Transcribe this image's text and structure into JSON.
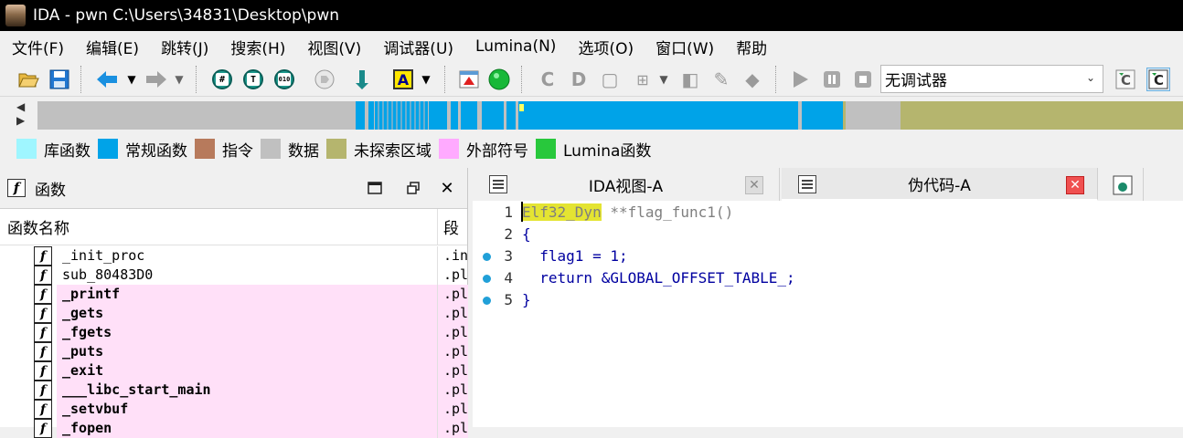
{
  "window": {
    "title": "IDA - pwn C:\\Users\\34831\\Desktop\\pwn"
  },
  "menu": [
    "文件(F)",
    "编辑(E)",
    "跳转(J)",
    "搜索(H)",
    "视图(V)",
    "调试器(U)",
    "Lumina(N)",
    "选项(O)",
    "窗口(W)",
    "帮助"
  ],
  "toolbar": {
    "icons": [
      "open-icon",
      "save-icon",
      "back-arrow-icon",
      "forward-arrow-icon",
      "hash-icon",
      "text-icon",
      "binary-icon",
      "script-icon",
      "jump-icon",
      "font-a-icon",
      "flag-icon",
      "green-circle-icon",
      "code-c-icon",
      "data-d-icon",
      "struct-icon",
      "plus-icon",
      "pointer-icon",
      "hammer-icon",
      "diamond-icon",
      "play-icon",
      "pause-icon",
      "stop-icon",
      "refresh-c-icon",
      "refresh-c-active-icon"
    ],
    "debugger_select": "无调试器"
  },
  "legend": [
    {
      "label": "库函数",
      "color": "#9ff6ff"
    },
    {
      "label": "常规函数",
      "color": "#00a3e8"
    },
    {
      "label": "指令",
      "color": "#b77a5c"
    },
    {
      "label": "数据",
      "color": "#c0c0c0"
    },
    {
      "label": "未探索区域",
      "color": "#b5b56e"
    },
    {
      "label": "外部符号",
      "color": "#ffaaff"
    },
    {
      "label": "Lumina函数",
      "color": "#28c83c"
    }
  ],
  "functions_panel": {
    "title": "函数",
    "col_name": "函数名称",
    "col_segment": "段",
    "rows": [
      {
        "name": "_init_proc",
        "segment": ".init",
        "highlight": false
      },
      {
        "name": "sub_80483D0",
        "segment": ".plt",
        "highlight": false
      },
      {
        "name": "_printf",
        "segment": ".plt",
        "highlight": true
      },
      {
        "name": "_gets",
        "segment": ".plt",
        "highlight": true
      },
      {
        "name": "_fgets",
        "segment": ".plt",
        "highlight": true
      },
      {
        "name": "_puts",
        "segment": ".plt",
        "highlight": true
      },
      {
        "name": "_exit",
        "segment": ".plt",
        "highlight": true
      },
      {
        "name": "___libc_start_main",
        "segment": ".plt",
        "highlight": true
      },
      {
        "name": "_setvbuf",
        "segment": ".plt",
        "highlight": true
      },
      {
        "name": "_fopen",
        "segment": ".plt",
        "highlight": true
      }
    ]
  },
  "tabs": [
    {
      "label": "IDA视图-A"
    },
    {
      "label": "伪代码-A"
    }
  ],
  "code": {
    "lines": [
      {
        "num": "1",
        "type": "Elf32_Dyn",
        "rest": " **flag_func1()"
      },
      {
        "num": "2",
        "text": "{"
      },
      {
        "num": "3",
        "text": "  flag1 = 1;"
      },
      {
        "num": "4",
        "text": "  return &GLOBAL_OFFSET_TABLE_;"
      },
      {
        "num": "5",
        "text": "}"
      }
    ]
  }
}
